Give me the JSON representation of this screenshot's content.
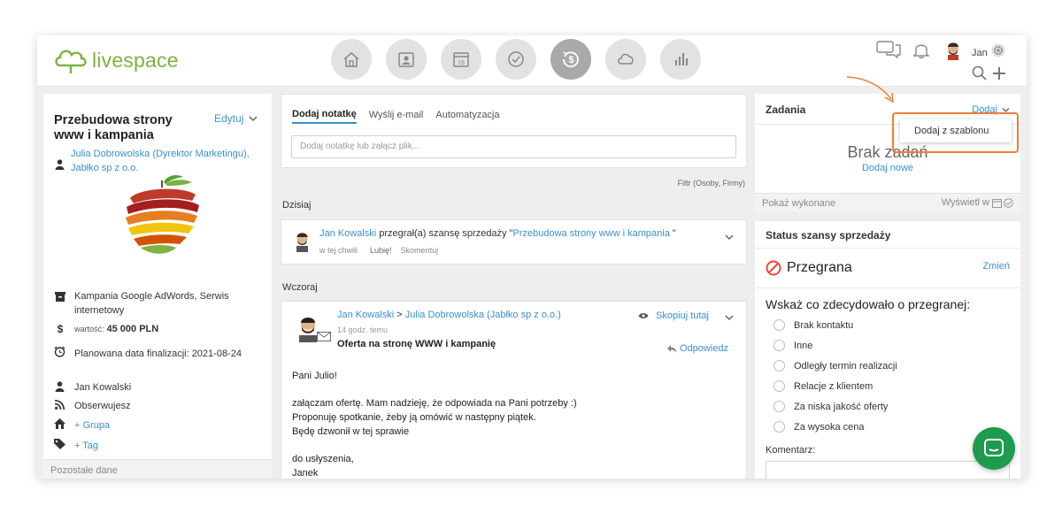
{
  "logo": {
    "text": "livespace"
  },
  "nav": [
    "home-icon",
    "contacts-icon",
    "calendar-icon",
    "tasks-icon",
    "deals-icon",
    "cloud-icon",
    "reports-icon"
  ],
  "user": {
    "name": "Jan"
  },
  "deal": {
    "title": "Przebudowa strony www i kampania",
    "edit_label": "Edytuj",
    "contact": "Julia Dobrowolska (Dyrektor Marketingu),",
    "company": "Jabłko sp z o.o.",
    "campaign": "Kampania Google AdWords, Serwis internetowy",
    "value_label": "wartość:",
    "value": "45 000 PLN",
    "date_label": "Planowana data finalizacji: 2021-08-24",
    "owner": "Jan Kowalski",
    "observe": "Obserwujesz",
    "group": "+ Grupa",
    "tag": "+ Tag",
    "other_data": "Pozostałe dane"
  },
  "composer": {
    "tabs": [
      "Dodaj notatkę",
      "Wyślij e-mail",
      "Automatyzacja"
    ],
    "placeholder": "Dodaj notatkę lub załącz plik...",
    "filter": "Filtr (Osoby, Firmy)"
  },
  "feed": {
    "today_label": "Dzisiaj",
    "yesterday_label": "Wczoraj",
    "today_item": {
      "author": "Jan Kowalski",
      "action": "przegrał(a) szansę sprzedaży \"",
      "deal": "Przebudowa strony www i kampania",
      "action_end": "\"",
      "time": "w tej chwili",
      "like": "Lubię!",
      "comment": "Skomentuj"
    },
    "email_item": {
      "author": "Jan Kowalski",
      "sep": ">",
      "recipient": "Julia Dobrowolska (Jabłko sp z o.o.)",
      "time": "14 godz. temu",
      "subject": "Oferta na stronę WWW i kampanię",
      "copy_label": "Skopiuj tutaj",
      "reply_label": "Odpowiedz",
      "body": [
        "Pani Julio!",
        "",
        "załączam ofertę. Mam nadzieję, że odpowiada na Pani potrzeby :)",
        "Proponuję spotkanie, żeby ją omówić w następny piątek.",
        "Będę dzwonił w tej sprawie",
        "",
        "do usłyszenia,",
        "Janek"
      ]
    }
  },
  "tasks": {
    "title": "Zadania",
    "add_label": "Dodaj",
    "dropdown_item": "Dodaj z szablonu",
    "empty": "Brak zadań",
    "add_new": "Dodaj nowe",
    "show_done": "Pokaż wykonane",
    "show_in": "Wyświetl w"
  },
  "status": {
    "title": "Status szansy sprzedaży",
    "state": "Przegrana",
    "change": "Zmień",
    "question": "Wskaż co zdecydowało o przegranej:",
    "reasons": [
      "Brak kontaktu",
      "Inne",
      "Odległy termin realizacji",
      "Relacje z klientem",
      "Za niska jakość oferty",
      "Za wysoka cena"
    ],
    "comment_label": "Komentarz:"
  },
  "colors": {
    "accent": "#3a8fd1",
    "logo": "#7cb342",
    "highlight": "#f07c33",
    "lost": "#e74c3c",
    "chat": "#1e9b4f"
  }
}
